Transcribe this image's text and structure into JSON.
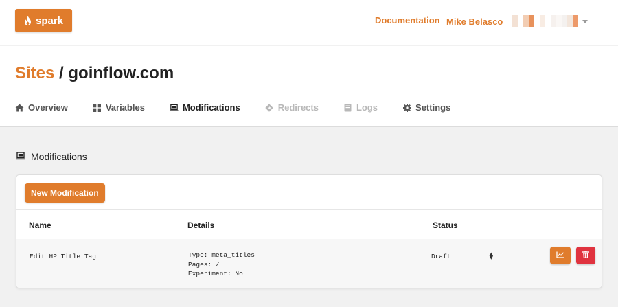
{
  "brand": {
    "name": "spark",
    "icon": "flame-icon",
    "color": "#e07c2c"
  },
  "nav": {
    "documentation_label": "Documentation",
    "user_name": "Mike Belasco",
    "avatar_colors": [
      "#ffffff",
      "#f3e1d4",
      "#ffffff",
      "#f2cdb3",
      "#e8925c",
      "#ffffff",
      "#f8ece3",
      "#ffffff",
      "#f6f1ee",
      "#faf7f5",
      "#f4f1ef",
      "#f3e6dc",
      "#ed9a6a"
    ]
  },
  "breadcrumb": {
    "parent": "Sites",
    "separator": " / ",
    "current": "goinflow.com"
  },
  "tabs": [
    {
      "label": "Overview",
      "icon": "home-icon",
      "state": "normal"
    },
    {
      "label": "Variables",
      "icon": "grid-icon",
      "state": "normal"
    },
    {
      "label": "Modifications",
      "icon": "laptop-icon",
      "state": "active"
    },
    {
      "label": "Redirects",
      "icon": "diamond-arrow-icon",
      "state": "disabled"
    },
    {
      "label": "Logs",
      "icon": "book-icon",
      "state": "disabled"
    },
    {
      "label": "Settings",
      "icon": "gear-icon",
      "state": "normal"
    }
  ],
  "section": {
    "title": "Modifications",
    "icon": "laptop-icon"
  },
  "table": {
    "new_button_label": "New Modification",
    "columns": {
      "name": "Name",
      "details": "Details",
      "status": "Status"
    },
    "rows": [
      {
        "name": "Edit HP Title Tag",
        "details": [
          "Type: meta_titles",
          "Pages: /",
          "Experiment: No"
        ],
        "status": "Draft"
      }
    ]
  },
  "colors": {
    "accent": "#e07c2c",
    "danger": "#e0333f"
  }
}
